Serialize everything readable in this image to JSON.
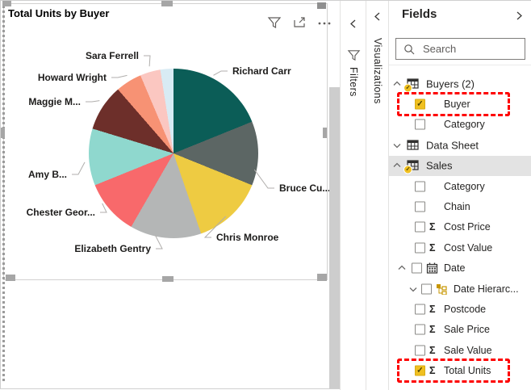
{
  "chart_data": {
    "type": "pie",
    "title": "Total Units by Buyer",
    "legend": "none",
    "label_style": "category-names-outside",
    "slices": [
      {
        "label": "Richard Carr",
        "pct": 18.9,
        "start_deg": 0,
        "end_deg": 68,
        "color": "#0b5d57"
      },
      {
        "label": "Bruce Cu...",
        "pct": 12.2,
        "start_deg": 68,
        "end_deg": 112,
        "color": "#5c6664"
      },
      {
        "label": "Chris Monroe",
        "pct": 13.6,
        "start_deg": 112,
        "end_deg": 161,
        "color": "#eecb42"
      },
      {
        "label": "Elizabeth Gentry",
        "pct": 13.6,
        "start_deg": 161,
        "end_deg": 210,
        "color": "#b4b6b6"
      },
      {
        "label": "Chester Geor...",
        "pct": 10.6,
        "start_deg": 210,
        "end_deg": 248,
        "color": "#f8696b"
      },
      {
        "label": "Amy B...",
        "pct": 10.8,
        "start_deg": 248,
        "end_deg": 287,
        "color": "#8fd8ce"
      },
      {
        "label": "Maggie M...",
        "pct": 8.9,
        "start_deg": 287,
        "end_deg": 319,
        "color": "#6d2f2a"
      },
      {
        "label": "Howard Wright",
        "pct": 5.0,
        "start_deg": 319,
        "end_deg": 337,
        "color": "#f79274"
      },
      {
        "label": "Sara Ferrell",
        "pct": 3.9,
        "start_deg": 337,
        "end_deg": 351,
        "color": "#fbc7c1"
      },
      {
        "label": "",
        "pct": 2.5,
        "start_deg": 351,
        "end_deg": 360,
        "color": "#d8ebf4"
      }
    ]
  },
  "canvas": {
    "visual": {
      "title": "Total Units by Buyer",
      "header_icons": [
        "filter-icon",
        "focus-mode-icon",
        "more-options-icon"
      ],
      "selected": true
    }
  },
  "panes": {
    "filters": {
      "label": "Filters",
      "collapsed": true,
      "icons": [
        "chevron-left-icon",
        "funnel-icon"
      ]
    },
    "visualizations": {
      "label": "Visualizations",
      "collapsed": true,
      "icons": [
        "chevron-left-icon"
      ]
    },
    "fields": {
      "title": "Fields",
      "collapse_icon": "chevron-right-icon",
      "search_placeholder": "Search",
      "accent_color": "#f0c020",
      "highlight_color": "#fe0000",
      "tree": [
        {
          "label": "Buyers (2)",
          "type": "table",
          "expanded": true,
          "badge": true
        },
        {
          "label": "Buyer",
          "type": "field",
          "checked": true,
          "outlined": true
        },
        {
          "label": "Category",
          "type": "field",
          "checked": false
        },
        {
          "label": "Data Sheet",
          "type": "table",
          "expanded": false,
          "badge": false
        },
        {
          "label": "Sales",
          "type": "table",
          "expanded": true,
          "badge": true,
          "selected": true
        },
        {
          "label": "Category",
          "type": "field",
          "checked": false
        },
        {
          "label": "Chain",
          "type": "field",
          "checked": false
        },
        {
          "label": "Cost Price",
          "type": "field",
          "sigma": true,
          "checked": false
        },
        {
          "label": "Cost Value",
          "type": "field",
          "sigma": true,
          "checked": false
        },
        {
          "label": "Date",
          "type": "date",
          "expanded": true,
          "checked": false
        },
        {
          "label": "Date Hierarc...",
          "type": "hierarchy",
          "expanded": false,
          "checked": false
        },
        {
          "label": "Postcode",
          "type": "field",
          "sigma": true,
          "checked": false
        },
        {
          "label": "Sale Price",
          "type": "field",
          "sigma": true,
          "checked": false
        },
        {
          "label": "Sale Value",
          "type": "field",
          "sigma": true,
          "checked": false
        },
        {
          "label": "Total Units",
          "type": "field",
          "sigma": true,
          "checked": true,
          "outlined": true
        }
      ]
    }
  }
}
